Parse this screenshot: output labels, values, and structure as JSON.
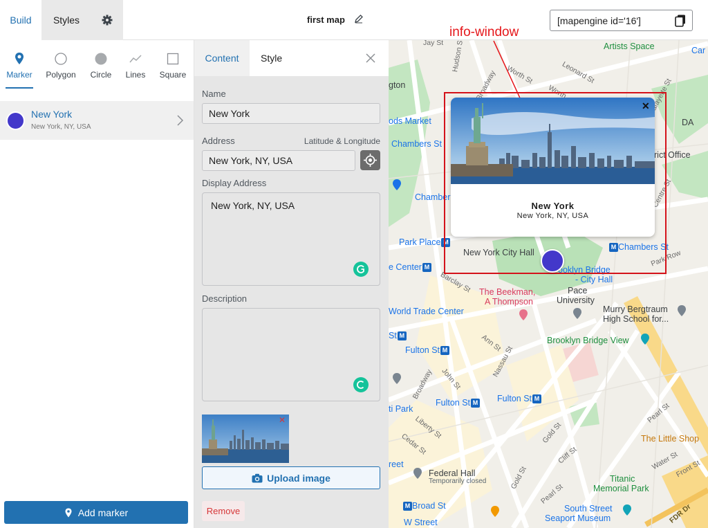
{
  "topbar": {
    "tabs": [
      "Build",
      "Styles"
    ],
    "map_title": "first map",
    "shortcode": "[mapengine id='16']"
  },
  "left": {
    "shape_tabs": [
      "Marker",
      "Polygon",
      "Circle",
      "Lines",
      "Square"
    ],
    "marker": {
      "name": "New York",
      "address": "New York, NY, USA",
      "color": "#4338ca"
    },
    "add_marker_label": "Add marker"
  },
  "editor": {
    "tabs": [
      "Content",
      "Style"
    ],
    "name_label": "Name",
    "name_value": "New York",
    "address_label": "Address",
    "latlng_label": "Latitude & Longitude",
    "address_value": "New York, NY, USA",
    "display_address_label": "Display Address",
    "display_address_value": "New York, NY, USA",
    "description_label": "Description",
    "description_value": "",
    "upload_label": "Upload image",
    "remove_label": "Remove"
  },
  "annotation": {
    "label": "info-window",
    "color": "#e5161a"
  },
  "info_window": {
    "title": "New York",
    "address": "New York, NY, USA"
  },
  "map": {
    "places": {
      "artists_space": "Artists Space",
      "car": "Car",
      "gton": "gton",
      "market": "ods Market",
      "chambers_st": "Chambers St",
      "chamber": "Chamber",
      "park_place": "Park Place",
      "center": "e Center",
      "nyc_hall": "New York City Hall",
      "brooklyn_bridge": "ooklyn Bridge",
      "city_hall": "- City Hall",
      "chambers_st2": "Chambers St",
      "beekman1": "The Beekman,",
      "beekman2": "A Thompson",
      "pace1": "Pace",
      "pace2": "University",
      "wtc": "World Trade Center",
      "murry1": "Murry Bergtraum",
      "murry2": "High School for...",
      "st": "St",
      "fulton_st": "Fulton St",
      "bbv": "Brooklyn Bridge View",
      "fulton_st2": "Fulton St",
      "fulton_st3": "Fulton St",
      "ti_park": "ti Park",
      "little_shop": "The Little Shop",
      "reet": "reet",
      "federal1": "Federal Hall",
      "federal2": "Temporarily closed",
      "titanic1": "Titanic",
      "titanic2": "Memorial Park",
      "broad_st": "Broad St",
      "south_st1": "South Street",
      "south_st2": "Seaport Museum",
      "da": "DA",
      "ict_office": "rict Office",
      "w_street": "W Street"
    },
    "streets": {
      "jay": "Jay St",
      "hudson": "Hudson St",
      "broadway": "Broadway",
      "worth": "Worth St",
      "leonard": "Leonard St",
      "worth2": "Worth",
      "lafayette": "Lafayette St",
      "centre": "Centre St",
      "barclay": "Barclay St",
      "park_row": "Park Row",
      "ann": "Ann St",
      "nassau": "Nassau St",
      "john": "John St",
      "broadway2": "Broadway",
      "liberty": "Liberty St",
      "cedar": "Cedar St",
      "gold": "Gold St",
      "cliff": "Cliff St",
      "pearl": "Pearl St",
      "water": "Water St",
      "front": "Front St",
      "gold2": "Gold St",
      "pearl2": "Pearl St",
      "fdr": "FDR Dr"
    }
  }
}
